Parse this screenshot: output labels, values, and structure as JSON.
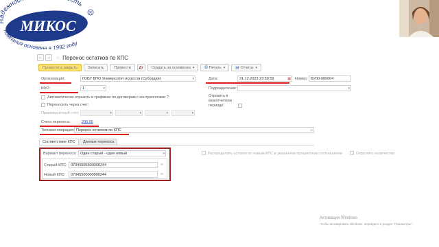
{
  "logo": {
    "top_text": "Надежность и стабильность",
    "registered": "R",
    "brand": "МИКОС",
    "bottom_text": "Компания основана в 1992 году"
  },
  "colors": {
    "brand_blue": "#1e3a8a",
    "accent_yellow": "#fde26b",
    "underline_red": "#e01a1a",
    "box_red": "#a02020"
  },
  "window": {
    "title": "Перенос остатков по КПС"
  },
  "toolbar": {
    "post_close": "Провести и закрыть",
    "save": "Записать",
    "post": "Провести",
    "create_based": "Создать на основании",
    "print": "Печать",
    "reports": "Отчеты"
  },
  "form": {
    "org_label": "Организация:",
    "org_value": "ГОБУ ВПО Университет искусств (Субсидия)",
    "date_label": "Дата:",
    "date_value": "31.12.2023 23:59:59",
    "number_label": "Номер:",
    "number_value": "БУ00-000004",
    "kfo_label": "КФО:",
    "kfo_value": "1",
    "division_label": "Подразделение:",
    "auto_reflect_label": "Автоматически отразить в графиках по договорам с контрагентами",
    "help_mark": "?",
    "transfer_via_label": "Переносить через счет:",
    "intermediate_label": "Промежуточный счет:",
    "reflect_label_line1": "Отразить в",
    "reflect_label_line2": "межотчетном",
    "reflect_label_line3": "периоде:",
    "accounts_label": "Счета переноса:",
    "accounts_value": "205.55",
    "operation_label": "Типовая операция:",
    "operation_value": "Перенос остатков по КПС"
  },
  "tabs": {
    "kps": "Соответствие КПС",
    "transfer_data": "Данные переноса"
  },
  "kps_panel": {
    "variant_label": "Вариант переноса:",
    "variant_value": "Один старый - один новый",
    "distribute_label": "Распределить остатки по новым КПС в указанном процентном соотношении",
    "round_label": "Округлять количество",
    "old_label": "Старый КПС:",
    "old_value": "07040005500000244",
    "new_label": "Новый КПС:",
    "new_value": "07045500000000244"
  },
  "watermark": {
    "line1": "Активация Windows",
    "line2": "Чтобы активировать Windows, перейдите в раздел \"Параметры\"."
  }
}
